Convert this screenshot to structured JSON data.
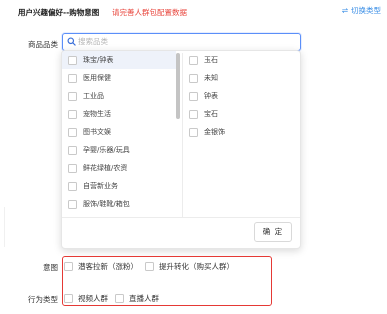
{
  "header": {
    "title": "用户兴趣偏好--购物意图",
    "warning": "请完善人群包配置数据",
    "switch_label": "切换类型",
    "switch_icon": "⇌"
  },
  "category": {
    "label": "商品品类",
    "search_placeholder": "搜索品类",
    "column1": [
      "珠宝/钟表",
      "医用保健",
      "工业品",
      "宠物生活",
      "图书文娱",
      "孕婴/乐器/玩具",
      "鲜花绿植/农资",
      "自营新业务",
      "服饰/鞋靴/箱包"
    ],
    "column2": [
      "玉石",
      "未知",
      "钟表",
      "宝石",
      "金银饰"
    ],
    "highlighted_item": "珠宝/钟表",
    "confirm_label": "确 定"
  },
  "intent": {
    "label": "意图",
    "options": [
      "潜客拉新（涨粉）",
      "提升转化（购买人群）"
    ]
  },
  "behavior": {
    "label": "行为类型",
    "options": [
      "视频人群",
      "直播人群"
    ]
  },
  "colors": {
    "accent": "#3a8ee6",
    "warning": "#e8453c",
    "highlight_box": "#e53935",
    "search_border": "#5b8ff9"
  }
}
